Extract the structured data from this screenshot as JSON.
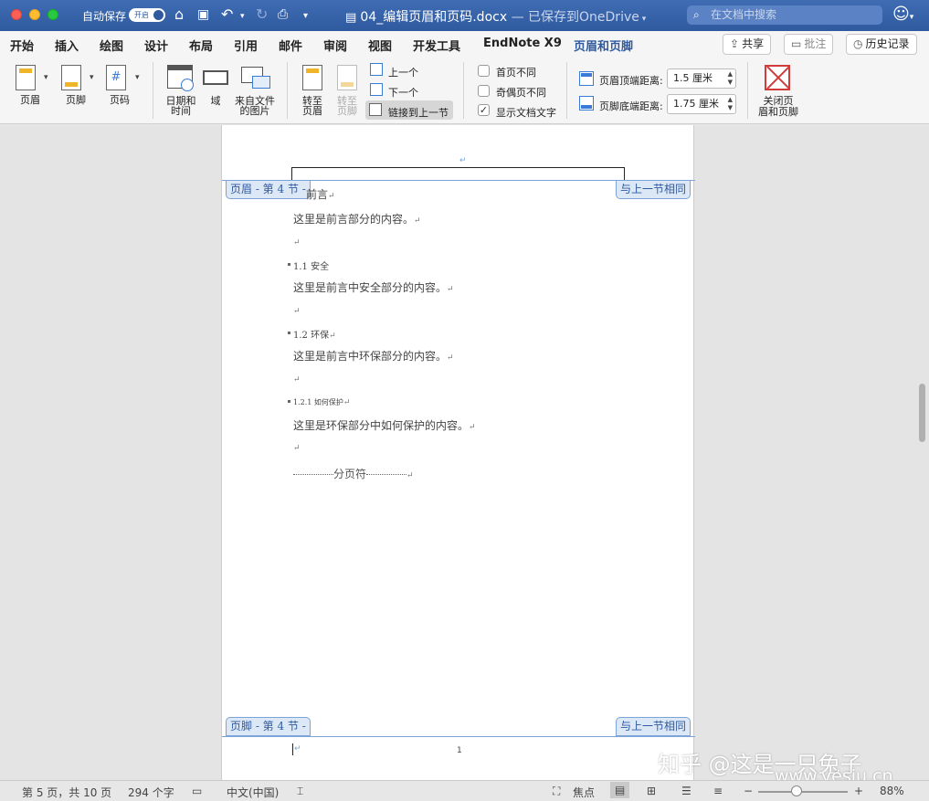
{
  "titlebar": {
    "autosave_label": "自动保存",
    "autosave_state": "开启",
    "doc_name": "04_编辑页眉和页码.docx",
    "saved_status": " — 已保存到OneDrive",
    "search_placeholder": "在文档中搜索"
  },
  "tabs": [
    "开始",
    "插入",
    "绘图",
    "设计",
    "布局",
    "引用",
    "邮件",
    "审阅",
    "视图",
    "开发工具",
    "EndNote X9",
    "页眉和页脚"
  ],
  "active_tab": "页眉和页脚",
  "top_buttons": {
    "share": "共享",
    "comments": "批注",
    "history": "历史记录"
  },
  "ribbon": {
    "header": "页眉",
    "footer": "页脚",
    "page_number": "页码",
    "date_time_l1": "日期和",
    "date_time_l2": "时间",
    "field": "域",
    "picture_l1": "来自文件",
    "picture_l2": "的图片",
    "goto_header_l1": "转至",
    "goto_header_l2": "页眉",
    "goto_footer_l1": "转至",
    "goto_footer_l2": "页脚",
    "previous": "上一个",
    "next": "下一个",
    "link_to_previous": "链接到上一节",
    "different_first": "首页不同",
    "different_odd_even": "奇偶页不同",
    "show_doc_text": "显示文档文字",
    "header_from_top_label": "页眉顶端距离:",
    "header_from_top_value": "1.5 厘米",
    "footer_from_bottom_label": "页脚底端距离:",
    "footer_from_bottom_value": "1.75 厘米",
    "close_l1": "关闭页",
    "close_l2": "眉和页脚"
  },
  "checkboxes": {
    "different_first": false,
    "different_odd_even": false,
    "show_doc_text": true
  },
  "document": {
    "header_tag": "页眉 - 第 4 节 -",
    "footer_tag": "页脚 - 第 4 节 -",
    "same_as_previous": "与上一节相同",
    "mark": "↵",
    "h_preface": "前言",
    "p_preface": "这里是前言部分的内容。",
    "h_safety": "1.1 安全",
    "p_safety": "这里是前言中安全部分的内容。",
    "h_env": "1.2 环保",
    "p_env": "这里是前言中环保部分的内容。",
    "h_protect": "1.2.1  如何保护",
    "p_protect": "这里是环保部分中如何保护的内容。",
    "page_break": "分页符",
    "footer_page_number": "1"
  },
  "watermark": {
    "line1": "知乎 @这是一只兔子",
    "line2": "www.yesiu.cn"
  },
  "statusbar": {
    "page_info": "第 5 页，共 10 页",
    "word_count": "294 个字",
    "language": "中文(中国)",
    "focus": "焦点",
    "zoom": "88%"
  },
  "zoom_level": 0.88
}
